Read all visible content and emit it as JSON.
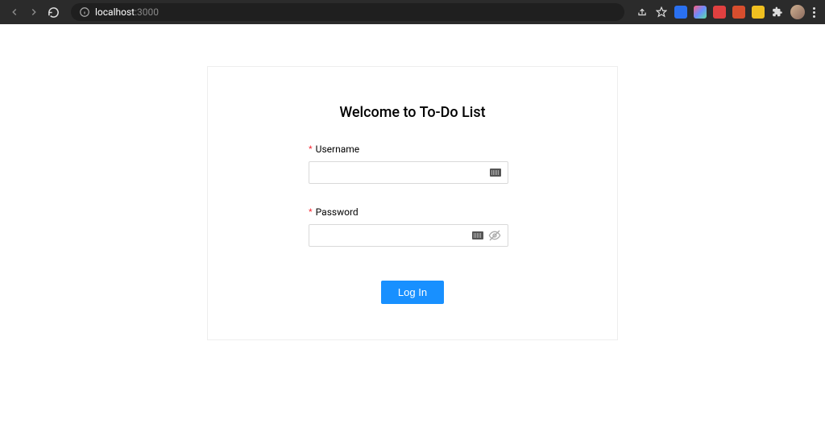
{
  "browser": {
    "url_host": "localhost",
    "url_port": ":3000"
  },
  "card": {
    "title": "Welcome to To-Do List"
  },
  "form": {
    "username_label": "Username",
    "password_label": "Password",
    "required_mark": "*",
    "login_label": "Log In"
  }
}
